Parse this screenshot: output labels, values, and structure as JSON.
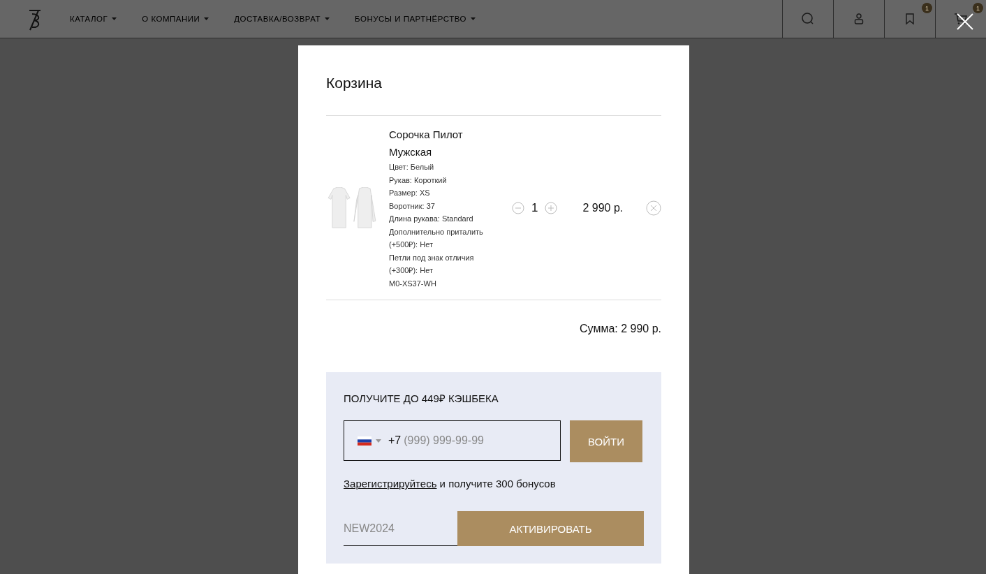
{
  "header": {
    "nav": [
      {
        "label": "КАТАЛОГ"
      },
      {
        "label": "О КОМПАНИИ"
      },
      {
        "label": "ДОСТАВКА/ВОЗВРАТ"
      },
      {
        "label": "БОНУСЫ И ПАРТНЁРСТВО"
      }
    ],
    "icons": [
      {
        "kind": "search"
      },
      {
        "kind": "account"
      },
      {
        "kind": "bookmark",
        "badge": "1"
      },
      {
        "kind": "cart",
        "badge": "1"
      }
    ]
  },
  "cart": {
    "title": "Корзина",
    "items": [
      {
        "name": "Сорочка Пилот Мужская",
        "options": [
          "Цвет: Белый",
          "Рукав: Короткий",
          "Размер: XS",
          "Воротник: 37",
          "Длина рукава: Standard",
          "Дополнительно приталить (+500₽): Нет",
          "Петли под знак отличия (+300₽): Нет",
          "M0-XS37-WH"
        ],
        "quantity": "1",
        "price": "2 990 р."
      }
    ],
    "total": "Сумма: 2 990 р.",
    "cashback": {
      "title": "ПОЛУЧИТЕ ДО 449₽ КЭШБЕКА",
      "phone_prefix": "+7",
      "phone_placeholder": "(999) 999-99-99",
      "login_button": "ВОЙТИ",
      "register_link": "Зарегистрируйтесь",
      "register_text": " и получите 300 бонусов",
      "promo_value": "NEW2024",
      "activate_button": "АКТИВИРОВАТЬ"
    }
  }
}
